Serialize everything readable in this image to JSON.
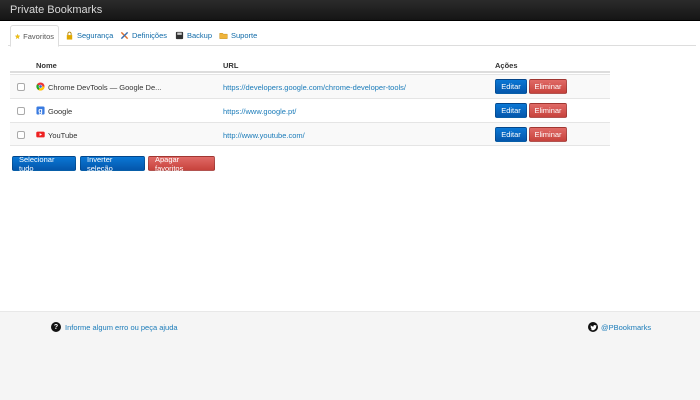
{
  "app": {
    "title": "Private Bookmarks"
  },
  "tabs": [
    {
      "label": "Favoritos",
      "icon": "star-icon",
      "active": true
    },
    {
      "label": "Segurança",
      "icon": "lock-icon"
    },
    {
      "label": "Definições",
      "icon": "tools-icon"
    },
    {
      "label": "Backup",
      "icon": "disk-icon"
    },
    {
      "label": "Suporte",
      "icon": "folder-icon"
    }
  ],
  "table": {
    "headers": {
      "name": "Nome",
      "url": "URL",
      "actions": "Ações"
    },
    "rows": [
      {
        "name": "Chrome DevTools — Google De...",
        "url": "https://developers.google.com/chrome-developer-tools/",
        "favicon": "chrome-icon"
      },
      {
        "name": "Google",
        "url": "https://www.google.pt/",
        "favicon": "google-icon"
      },
      {
        "name": "YouTube",
        "url": "http://www.youtube.com/",
        "favicon": "youtube-icon"
      }
    ],
    "edit_label": "Editar",
    "delete_label": "Eliminar"
  },
  "actions": {
    "select_all": "Selecionar tudo",
    "invert": "Inverter seleção",
    "delete": "Apagar favoritos"
  },
  "footer": {
    "help": "Informe algum erro ou peça ajuda",
    "twitter": "@PBookmarks"
  },
  "colors": {
    "link": "#1a7bb9",
    "primary": "#0866c6",
    "danger": "#d9534f",
    "navbar": "#1c1c1c"
  }
}
